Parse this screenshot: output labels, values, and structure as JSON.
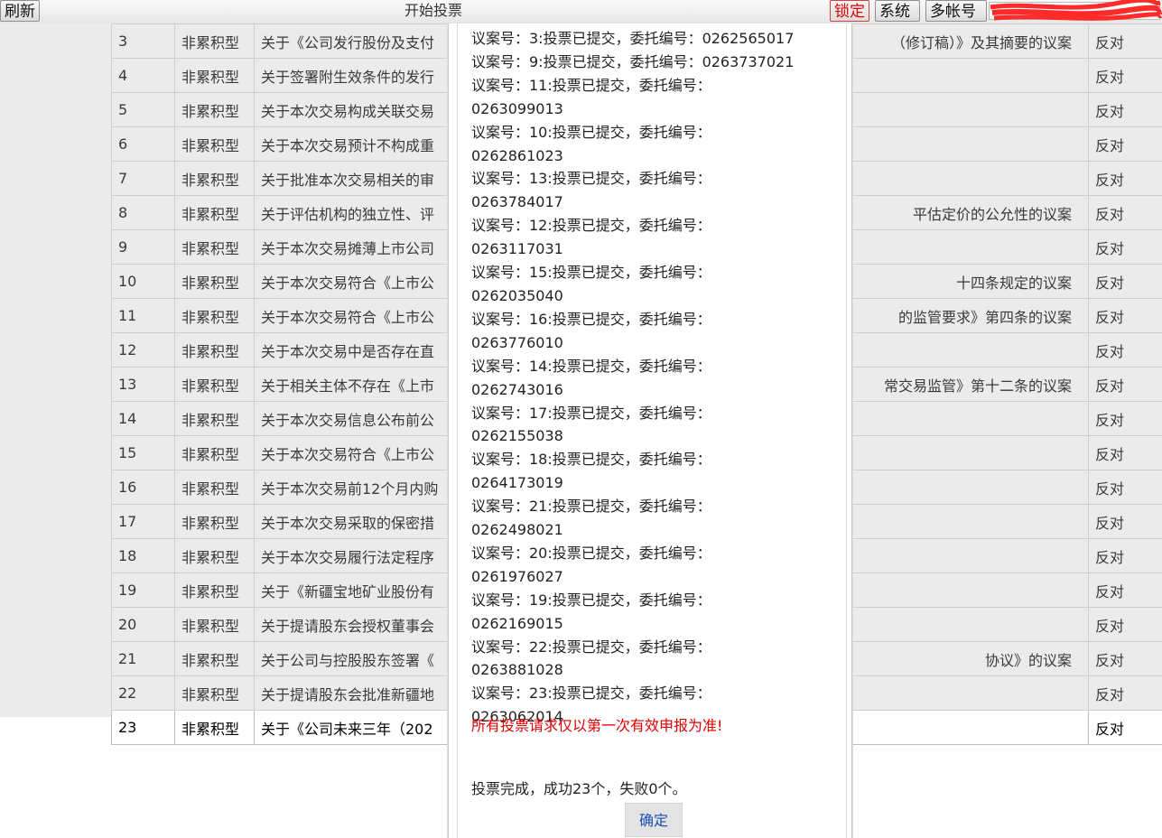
{
  "toolbar": {
    "refresh_label": "刷新",
    "title": "开始投票",
    "lock_label": "锁定",
    "system_label": "系统",
    "multi_account_label": "多帐号"
  },
  "table": {
    "rows": [
      {
        "no": "3",
        "type": "非累积型",
        "title_left": "关于《公司发行股份及支付",
        "title_right": "（修订稿）》及其摘要的议案",
        "vote": "反对"
      },
      {
        "no": "4",
        "type": "非累积型",
        "title_left": "关于签署附生效条件的发行",
        "title_right": "",
        "vote": "反对"
      },
      {
        "no": "5",
        "type": "非累积型",
        "title_left": "关于本次交易构成关联交易",
        "title_right": "",
        "vote": "反对"
      },
      {
        "no": "6",
        "type": "非累积型",
        "title_left": "关于本次交易预计不构成重",
        "title_right": "",
        "vote": "反对"
      },
      {
        "no": "7",
        "type": "非累积型",
        "title_left": "关于批准本次交易相关的审",
        "title_right": "",
        "vote": "反对"
      },
      {
        "no": "8",
        "type": "非累积型",
        "title_left": "关于评估机构的独立性、评",
        "title_right": "平估定价的公允性的议案",
        "vote": "反对"
      },
      {
        "no": "9",
        "type": "非累积型",
        "title_left": "关于本次交易摊薄上市公司",
        "title_right": "",
        "vote": "反对"
      },
      {
        "no": "10",
        "type": "非累积型",
        "title_left": "关于本次交易符合《上市公",
        "title_right": "十四条规定的议案",
        "vote": "反对"
      },
      {
        "no": "11",
        "type": "非累积型",
        "title_left": "关于本次交易符合《上市公",
        "title_right": "的监管要求》第四条的议案",
        "vote": "反对"
      },
      {
        "no": "12",
        "type": "非累积型",
        "title_left": "关于本次交易中是否存在直",
        "title_right": "",
        "vote": "反对"
      },
      {
        "no": "13",
        "type": "非累积型",
        "title_left": "关于相关主体不存在《上市",
        "title_right": "常交易监管》第十二条的议案",
        "vote": "反对"
      },
      {
        "no": "14",
        "type": "非累积型",
        "title_left": "关于本次交易信息公布前公",
        "title_right": "",
        "vote": "反对"
      },
      {
        "no": "15",
        "type": "非累积型",
        "title_left": "关于本次交易符合《上市公",
        "title_right": "",
        "vote": "反对"
      },
      {
        "no": "16",
        "type": "非累积型",
        "title_left": "关于本次交易前12个月内购",
        "title_right": "",
        "vote": "反对"
      },
      {
        "no": "17",
        "type": "非累积型",
        "title_left": "关于本次交易采取的保密措",
        "title_right": "",
        "vote": "反对"
      },
      {
        "no": "18",
        "type": "非累积型",
        "title_left": "关于本次交易履行法定程序",
        "title_right": "",
        "vote": "反对"
      },
      {
        "no": "19",
        "type": "非累积型",
        "title_left": "关于《新疆宝地矿业股份有",
        "title_right": "",
        "vote": "反对"
      },
      {
        "no": "20",
        "type": "非累积型",
        "title_left": "关于提请股东会授权董事会",
        "title_right": "",
        "vote": "反对"
      },
      {
        "no": "21",
        "type": "非累积型",
        "title_left": "关于公司与控股股东签署《",
        "title_right": "协议》的议案",
        "vote": "反对"
      },
      {
        "no": "22",
        "type": "非累积型",
        "title_left": "关于提请股东会批准新疆地",
        "title_right": "",
        "vote": "反对"
      },
      {
        "no": "23",
        "type": "非累积型",
        "title_left": "关于《公司未来三年（202",
        "title_right": "",
        "vote": "反对"
      }
    ]
  },
  "modal": {
    "messages": [
      "议案号：3:投票已提交，委托编号：0262565017",
      "议案号：9:投票已提交，委托编号：0263737021",
      "议案号：11:投票已提交，委托编号：",
      "0263099013",
      "议案号：10:投票已提交，委托编号：",
      "0262861023",
      "议案号：13:投票已提交，委托编号：",
      "0263784017",
      "议案号：12:投票已提交，委托编号：",
      "0263117031",
      "议案号：15:投票已提交，委托编号：",
      "0262035040",
      "议案号：16:投票已提交，委托编号：",
      "0263776010",
      "议案号：14:投票已提交，委托编号：",
      "0262743016",
      "议案号：17:投票已提交，委托编号：",
      "0262155038",
      "议案号：18:投票已提交，委托编号：",
      "0264173019",
      "议案号：21:投票已提交，委托编号：",
      "0262498021",
      "议案号：20:投票已提交，委托编号：",
      "0261976027",
      "议案号：19:投票已提交，委托编号：",
      "0262169015",
      "议案号：22:投票已提交，委托编号：",
      "0263881028",
      "议案号：23:投票已提交，委托编号：",
      "0263062014"
    ],
    "warning": "所有投票请求仅以第一次有效申报为准!",
    "result": "投票完成，成功23个，失败0个。",
    "ok_label": "确定"
  },
  "colors": {
    "warning": "#e00000",
    "overlay": "#ebebeb",
    "ok_text": "#1a4fb3"
  }
}
